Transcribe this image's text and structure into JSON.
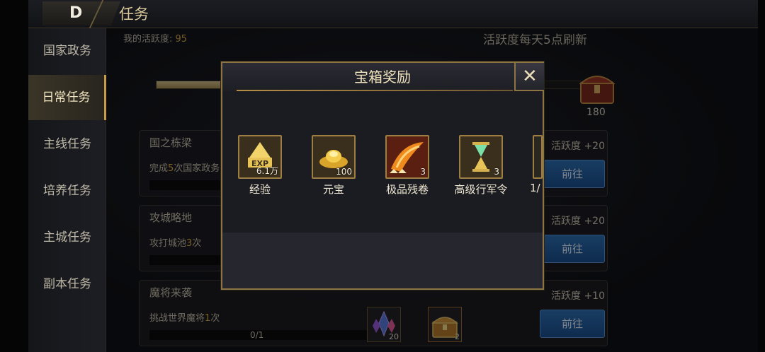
{
  "header": {
    "title": "任务"
  },
  "sidebar": {
    "items": [
      {
        "label": "国家政务"
      },
      {
        "label": "日常任务"
      },
      {
        "label": "主线任务"
      },
      {
        "label": "培养任务"
      },
      {
        "label": "主城任务"
      },
      {
        "label": "副本任务"
      }
    ]
  },
  "activity": {
    "label": "我的活跃度:",
    "value": "95",
    "refresh_note": "活跃度每天5点刷新",
    "chest_value": "180"
  },
  "tasks": [
    {
      "name": "国之栋梁",
      "desc_pre": "完成",
      "desc_num": "5",
      "desc_post": "次国家政务",
      "points": "活跃度 +20",
      "go": "前往"
    },
    {
      "name": "攻城略地",
      "desc_pre": "攻打城池",
      "desc_num": "3",
      "desc_post": "次",
      "points": "活跃度 +20",
      "go": "前往"
    },
    {
      "name": "魔将来袭",
      "desc_pre": "挑战世界魔将",
      "desc_num": "1",
      "desc_post": "次",
      "progress": "0/1",
      "points": "活跃度 +10",
      "go": "前往",
      "rewards": [
        {
          "count": "20"
        },
        {
          "count": "2"
        }
      ]
    }
  ],
  "modal": {
    "title": "宝箱奖励",
    "rewards": [
      {
        "icon": "exp-icon",
        "icon_text": "EXP",
        "amount": "6.1万",
        "label": "经验"
      },
      {
        "icon": "gold-ingot-icon",
        "amount": "100",
        "label": "元宝"
      },
      {
        "icon": "scroll-icon",
        "amount": "3",
        "label": "极品残卷"
      },
      {
        "icon": "hourglass-icon",
        "amount": "3",
        "label": "高级行军令"
      },
      {
        "icon": "partial-item-icon",
        "amount": "",
        "label": "1/"
      }
    ]
  },
  "colors": {
    "accent_gold": "#c99b47",
    "button_blue": "#2d6fb4",
    "highlight_number": "#dfae3f"
  }
}
